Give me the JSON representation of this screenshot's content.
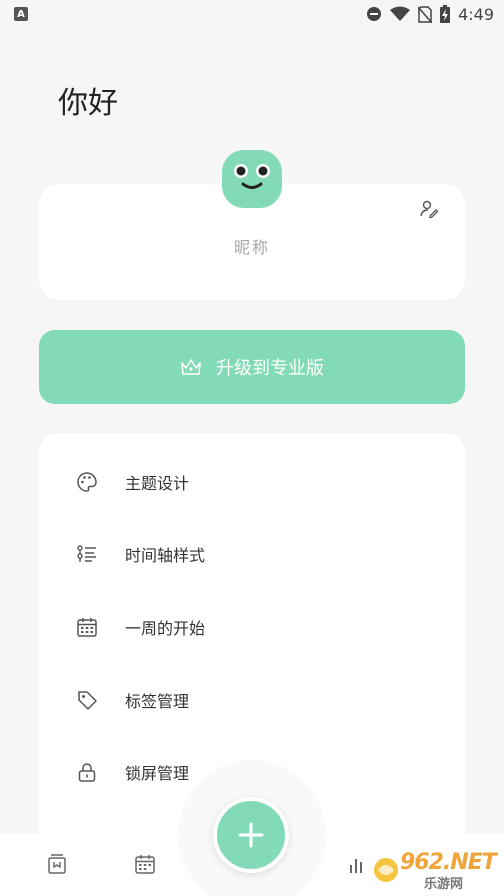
{
  "status_bar": {
    "app_indicator": "A",
    "time": "4:49",
    "icons": [
      "app-notification-icon",
      "do-not-disturb-icon",
      "wifi-icon",
      "no-sim-icon",
      "battery-charging-icon"
    ]
  },
  "header": {
    "greeting": "你好"
  },
  "profile": {
    "nickname": "昵称",
    "avatar_color": "#83dab7",
    "edit_icon": "user-edit-icon"
  },
  "upgrade": {
    "label": "升级到专业版",
    "icon": "crown-icon",
    "color": "#83dab7"
  },
  "settings": {
    "items": [
      {
        "label": "主题设计",
        "icon": "palette-icon"
      },
      {
        "label": "时间轴样式",
        "icon": "timeline-list-icon"
      },
      {
        "label": "一周的开始",
        "icon": "calendar-icon"
      },
      {
        "label": "标签管理",
        "icon": "tag-icon"
      },
      {
        "label": "锁屏管理",
        "icon": "lock-icon"
      }
    ]
  },
  "bottom_nav": {
    "icons": [
      "archive-icon",
      "calendar-grid-icon",
      "stats-icon"
    ],
    "fab_icon": "plus-icon"
  },
  "watermark": {
    "brand": "962.NET",
    "sub": "乐游网"
  }
}
